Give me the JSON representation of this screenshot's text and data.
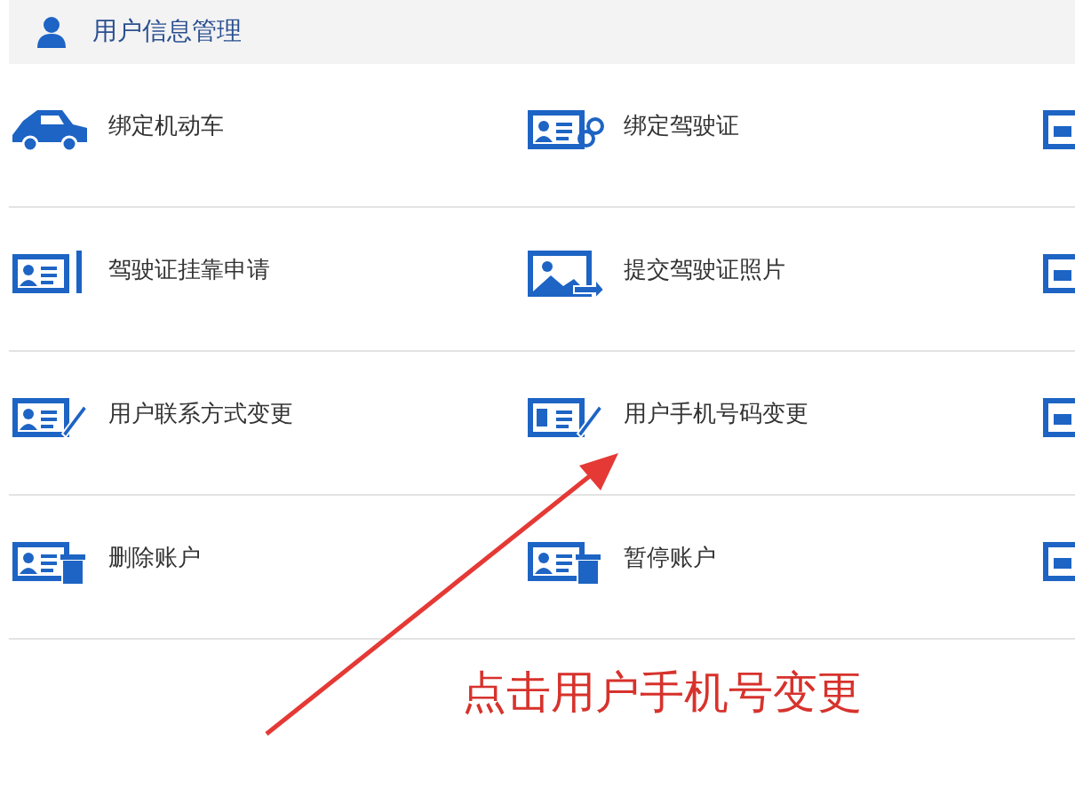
{
  "header": {
    "title": "用户信息管理"
  },
  "rows": [
    {
      "items": [
        {
          "label": "绑定机动车"
        },
        {
          "label": "绑定驾驶证"
        }
      ]
    },
    {
      "items": [
        {
          "label": "驾驶证挂靠申请"
        },
        {
          "label": "提交驾驶证照片"
        }
      ]
    },
    {
      "items": [
        {
          "label": "用户联系方式变更"
        },
        {
          "label": "用户手机号码变更"
        }
      ]
    },
    {
      "items": [
        {
          "label": "删除账户"
        },
        {
          "label": "暂停账户"
        }
      ]
    }
  ],
  "annotation": {
    "text": "点击用户手机号变更"
  }
}
